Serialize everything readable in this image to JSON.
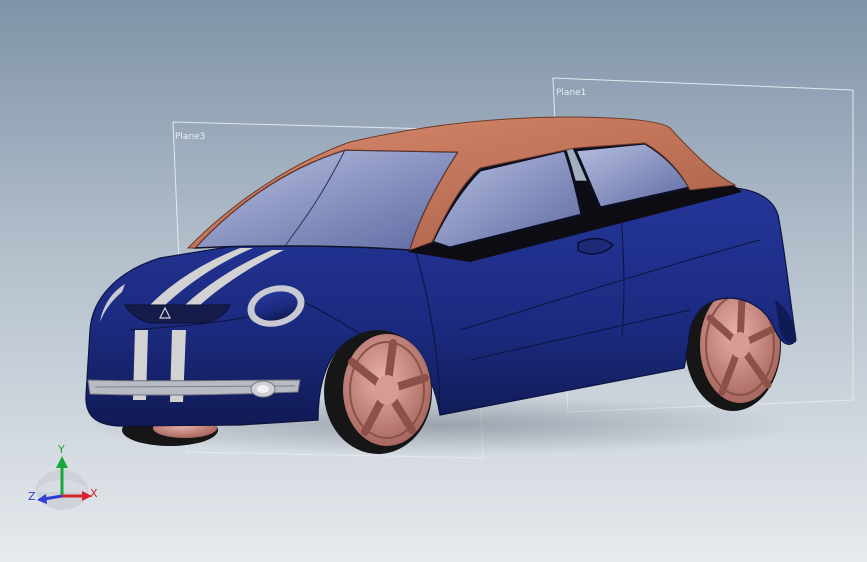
{
  "viewport": {
    "planes": [
      {
        "id": "plane3",
        "label": "Plane3"
      },
      {
        "id": "plane1",
        "label": "Plane1"
      }
    ],
    "triad": {
      "y": "Y",
      "z": "Z",
      "x": "X"
    }
  },
  "model": {
    "body_color": "#1b2a7e",
    "roof_color": "#c07258",
    "wheel_color": "#c98a82",
    "glass_color": "#9aa6cc",
    "stripe_color": "#d2d2d2"
  },
  "colors": {
    "background_top": "#7f93a8",
    "background_bottom": "#e7eaee",
    "axis_x": "#d9232e",
    "axis_y": "#16a83c",
    "axis_z": "#2f3cd6"
  }
}
